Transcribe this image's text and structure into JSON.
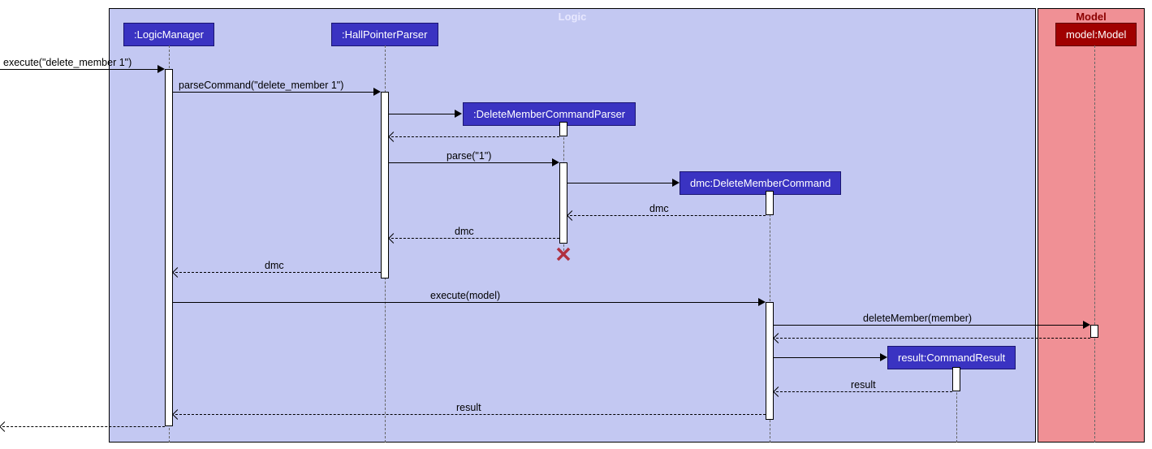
{
  "frames": {
    "logic": "Logic",
    "model": "Model"
  },
  "participants": {
    "logicManager": ":LogicManager",
    "hallPointerParser": ":HallPointerParser",
    "deleteMemberCommandParser": ":DeleteMemberCommandParser",
    "dmc": "dmc:DeleteMemberCommand",
    "commandResult": "result:CommandResult",
    "model": "model:Model"
  },
  "messages": {
    "execute": "execute(\"delete_member 1\")",
    "parseCommand": "parseCommand(\"delete_member 1\")",
    "parse": "parse(\"1\")",
    "dmcReturn1": "dmc",
    "dmcReturn2": "dmc",
    "dmcReturn3": "dmc",
    "executeModel": "execute(model)",
    "deleteMember": "deleteMember(member)",
    "resultReturn1": "result",
    "resultReturn2": "result"
  },
  "chart_data": {
    "type": "sequence-diagram",
    "frames": [
      {
        "name": "Logic",
        "contains": [
          ":LogicManager",
          ":HallPointerParser",
          ":DeleteMemberCommandParser",
          "dmc:DeleteMemberCommand",
          "result:CommandResult"
        ]
      },
      {
        "name": "Model",
        "contains": [
          "model:Model"
        ]
      }
    ],
    "participants": [
      ":LogicManager",
      ":HallPointerParser",
      ":DeleteMemberCommandParser",
      "dmc:DeleteMemberCommand",
      "result:CommandResult",
      "model:Model"
    ],
    "messages": [
      {
        "from": "external",
        "to": ":LogicManager",
        "label": "execute(\"delete_member 1\")",
        "type": "sync"
      },
      {
        "from": ":LogicManager",
        "to": ":HallPointerParser",
        "label": "parseCommand(\"delete_member 1\")",
        "type": "sync"
      },
      {
        "from": ":HallPointerParser",
        "to": ":DeleteMemberCommandParser",
        "label": "",
        "type": "create"
      },
      {
        "from": ":DeleteMemberCommandParser",
        "to": ":HallPointerParser",
        "label": "",
        "type": "return"
      },
      {
        "from": ":HallPointerParser",
        "to": ":DeleteMemberCommandParser",
        "label": "parse(\"1\")",
        "type": "sync"
      },
      {
        "from": ":DeleteMemberCommandParser",
        "to": "dmc:DeleteMemberCommand",
        "label": "",
        "type": "create"
      },
      {
        "from": "dmc:DeleteMemberCommand",
        "to": ":DeleteMemberCommandParser",
        "label": "dmc",
        "type": "return"
      },
      {
        "from": ":DeleteMemberCommandParser",
        "to": ":HallPointerParser",
        "label": "dmc",
        "type": "return"
      },
      {
        "from": ":DeleteMemberCommandParser",
        "to": null,
        "label": "",
        "type": "destroy"
      },
      {
        "from": ":HallPointerParser",
        "to": ":LogicManager",
        "label": "dmc",
        "type": "return"
      },
      {
        "from": ":LogicManager",
        "to": "dmc:DeleteMemberCommand",
        "label": "execute(model)",
        "type": "sync"
      },
      {
        "from": "dmc:DeleteMemberCommand",
        "to": "model:Model",
        "label": "deleteMember(member)",
        "type": "sync"
      },
      {
        "from": "model:Model",
        "to": "dmc:DeleteMemberCommand",
        "label": "",
        "type": "return"
      },
      {
        "from": "dmc:DeleteMemberCommand",
        "to": "result:CommandResult",
        "label": "",
        "type": "create"
      },
      {
        "from": "result:CommandResult",
        "to": "dmc:DeleteMemberCommand",
        "label": "result",
        "type": "return"
      },
      {
        "from": "dmc:DeleteMemberCommand",
        "to": ":LogicManager",
        "label": "result",
        "type": "return"
      },
      {
        "from": ":LogicManager",
        "to": "external",
        "label": "",
        "type": "return"
      }
    ]
  }
}
